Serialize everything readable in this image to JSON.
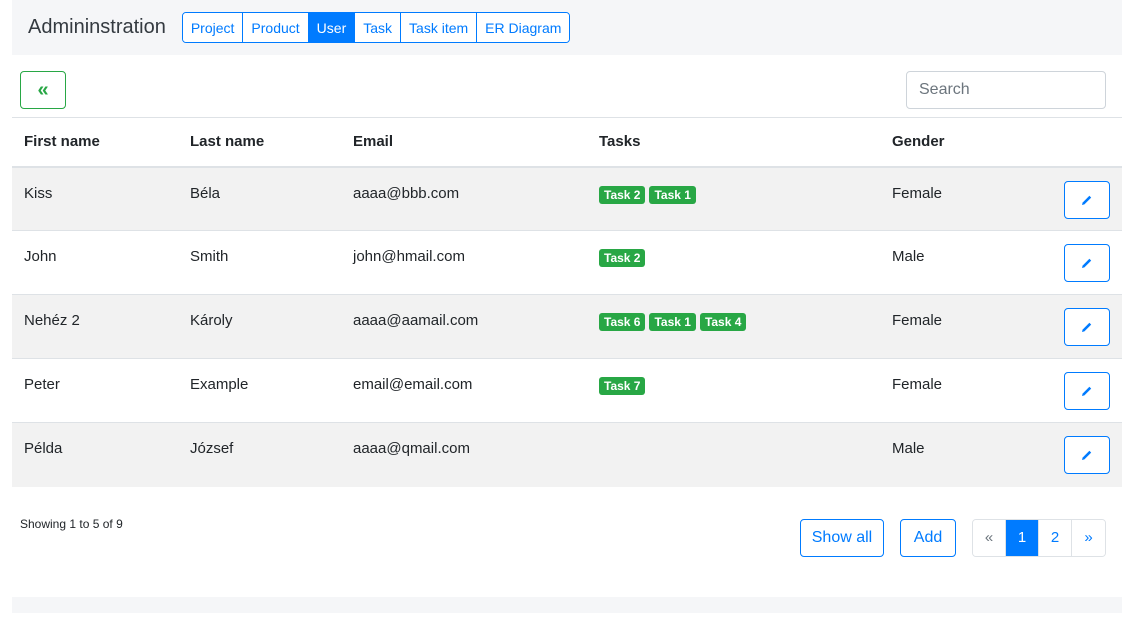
{
  "header": {
    "brand": "Admininstration",
    "nav": [
      {
        "label": "Project",
        "active": false
      },
      {
        "label": "Product",
        "active": false
      },
      {
        "label": "User",
        "active": true
      },
      {
        "label": "Task",
        "active": false
      },
      {
        "label": "Task item",
        "active": false
      },
      {
        "label": "ER Diagram",
        "active": false
      }
    ]
  },
  "toolbar": {
    "back_label": "«",
    "search_placeholder": "Search"
  },
  "table": {
    "columns": [
      "First name",
      "Last name",
      "Email",
      "Tasks",
      "Gender"
    ],
    "rows": [
      {
        "first": "Kiss",
        "last": "Béla",
        "email": "aaaa@bbb.com",
        "tasks": [
          "Task 2",
          "Task 1"
        ],
        "gender": "Female"
      },
      {
        "first": "John",
        "last": "Smith",
        "email": "john@hmail.com",
        "tasks": [
          "Task 2"
        ],
        "gender": "Male"
      },
      {
        "first": "Nehéz 2",
        "last": "Károly",
        "email": "aaaa@aamail.com",
        "tasks": [
          "Task 6",
          "Task 1",
          "Task 4"
        ],
        "gender": "Female"
      },
      {
        "first": "Peter",
        "last": "Example",
        "email": "email@email.com",
        "tasks": [
          "Task 7"
        ],
        "gender": "Female"
      },
      {
        "first": "Példa",
        "last": "József",
        "email": "aaaa@qmail.com",
        "tasks": [],
        "gender": "Male"
      }
    ],
    "edit_icon": "pencil-icon"
  },
  "footer": {
    "showing": "Showing 1 to 5 of 9",
    "show_all_label": "Show all",
    "add_label": "Add",
    "pagination": {
      "prev": "«",
      "pages": [
        "1",
        "2"
      ],
      "active": "1",
      "next": "»"
    }
  },
  "colors": {
    "primary": "#007bff",
    "success": "#28a745",
    "stripe": "#f2f2f2"
  }
}
